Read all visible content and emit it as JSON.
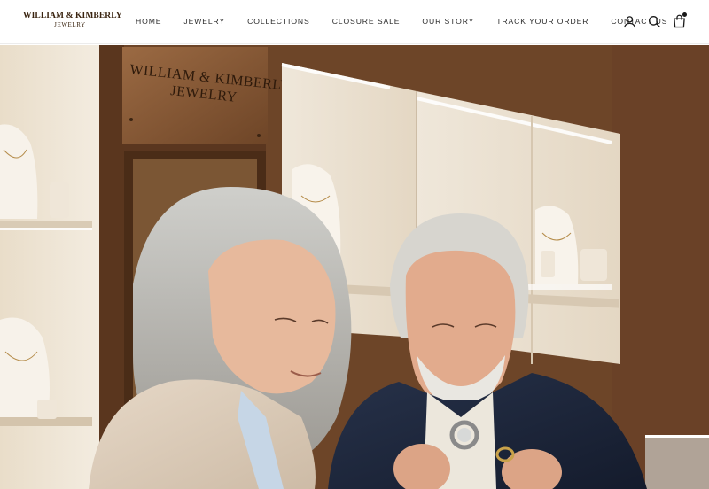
{
  "brand": {
    "name": "WILLIAM & KIMBERLY",
    "sub": "JEWELRY"
  },
  "nav": {
    "items": [
      {
        "label": "HOME"
      },
      {
        "label": "JEWELRY"
      },
      {
        "label": "COLLECTIONS"
      },
      {
        "label": "CLOSURE SALE"
      },
      {
        "label": "OUR STORY"
      },
      {
        "label": "TRACK YOUR ORDER"
      },
      {
        "label": "CONTACT US"
      }
    ]
  },
  "header_icons": {
    "account": "user-icon",
    "search": "search-icon",
    "cart": "shopping-bag-icon"
  },
  "hero": {
    "image": "hero-photo-couple-jewelry-store",
    "sign_line1": "WILLIAM & KIMBERLY",
    "sign_line2": "JEWELRY"
  },
  "colors": {
    "header_bg": "#ffffff",
    "brand_text": "#3a2410",
    "wood": "#6b4226",
    "display_case": "#efe6d8"
  }
}
